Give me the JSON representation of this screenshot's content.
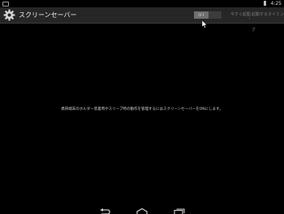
{
  "status_bar": {
    "time": "4:25",
    "notification_icon": "screenshot-icon",
    "battery_icon": "battery-icon"
  },
  "action_bar": {
    "app_icon": "gear-icon",
    "title": "スクリーンセーバー",
    "toggle_label": "OFF",
    "timer_button": "今すぐ起動",
    "start_button": "起動するタイミング"
  },
  "main": {
    "message": "携帯端末のホルダー装着時やスリープ時の動作を管理するにはスクリーンセーバーをONにします。"
  },
  "nav_bar": {
    "back_icon": "back-icon",
    "home_icon": "home-icon",
    "recent_icon": "recent-apps-icon"
  },
  "colors": {
    "background": "#000000",
    "action_bar": "#262626",
    "toggle_off": "#6e6e6e"
  }
}
